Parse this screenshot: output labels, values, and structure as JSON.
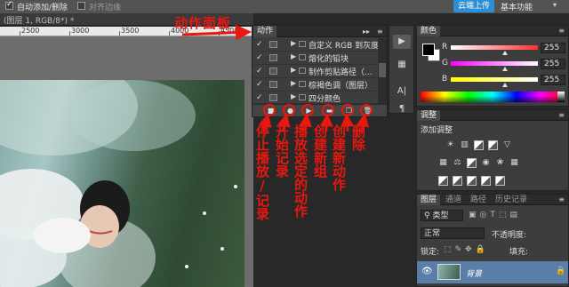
{
  "option_bar": {
    "auto_add_label": "自动添加/删除",
    "align_edges_label": "对齐边缘",
    "upload_label": "云端上传",
    "workspace": "基本功能"
  },
  "document": {
    "tab_title": "(图层 1, RGB/8*) *",
    "ruler_ticks": [
      "2500",
      "3000",
      "3500",
      "4000",
      "4500"
    ]
  },
  "actions_panel": {
    "tab_label": "动作",
    "items": [
      {
        "label": "自定义 RGB 到灰度",
        "checked": true
      },
      {
        "label": "熔化的铅块",
        "checked": true
      },
      {
        "label": "制作剪贴路径（...",
        "checked": true
      },
      {
        "label": "棕褐色调（图层）",
        "checked": true
      },
      {
        "label": "四分颜色",
        "checked": true
      }
    ],
    "footer_buttons": [
      "stop-icon",
      "record-icon",
      "play-icon",
      "new-set-icon",
      "new-action-icon",
      "delete-icon"
    ]
  },
  "tools": [
    "play-icon",
    "history-icon",
    "char-icon",
    "paragraph-icon"
  ],
  "color_panel": {
    "tab_label": "颜色",
    "channels": [
      {
        "label": "R",
        "value": "255",
        "color": "#ff3030"
      },
      {
        "label": "G",
        "value": "255",
        "color": "#22ff22"
      },
      {
        "label": "B",
        "value": "255",
        "color": "#2f5dff"
      }
    ]
  },
  "adjustments_panel": {
    "tab_label": "调整",
    "title": "添加调整"
  },
  "layers_panel": {
    "tabs": [
      "图层",
      "通道",
      "路径",
      "历史记录"
    ],
    "kind_label": "类型",
    "blend_mode": "正常",
    "opacity_label": "不透明度:",
    "lock_label": "锁定:",
    "fill_label": "填充:",
    "layer_name": "背景"
  },
  "annotations": {
    "panel_title": "动作面板",
    "labels": [
      "停止播放/记录",
      "开始记录",
      "播放选定的动作",
      "创建新组",
      "创建新动作",
      "删除"
    ],
    "color": "#e8170f"
  }
}
